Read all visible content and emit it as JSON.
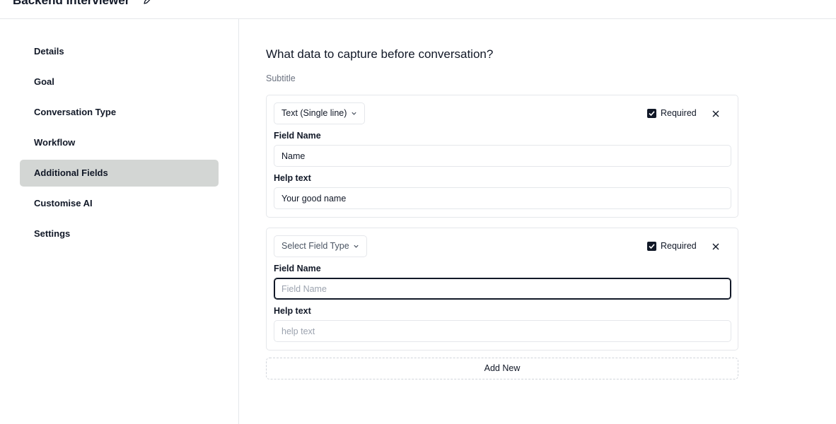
{
  "header": {
    "title": "Backend Interviewer",
    "edit_icon": "pencil-icon"
  },
  "sidebar": {
    "items": [
      {
        "label": "Details",
        "active": false
      },
      {
        "label": "Goal",
        "active": false
      },
      {
        "label": "Conversation Type",
        "active": false
      },
      {
        "label": "Workflow",
        "active": false
      },
      {
        "label": "Additional Fields",
        "active": true
      },
      {
        "label": "Customise AI",
        "active": false
      },
      {
        "label": "Settings",
        "active": false
      }
    ],
    "active_bg": "#d3d6d4"
  },
  "main": {
    "title": "What data to capture before conversation?",
    "subtitle": "Subtitle",
    "fields": [
      {
        "type_label": "Text (Single line)",
        "required_label": "Required",
        "required": true,
        "field_name_label": "Field Name",
        "field_name_value": "Name",
        "field_name_placeholder": "",
        "help_text_label": "Help text",
        "help_text_value": "Your good name",
        "help_text_placeholder": ""
      },
      {
        "type_label": "Select Field Type",
        "required_label": "Required",
        "required": true,
        "field_name_label": "Field Name",
        "field_name_value": "",
        "field_name_placeholder": "Field Name",
        "help_text_label": "Help text",
        "help_text_value": "",
        "help_text_placeholder": "help text"
      }
    ],
    "add_new_label": "Add New"
  }
}
